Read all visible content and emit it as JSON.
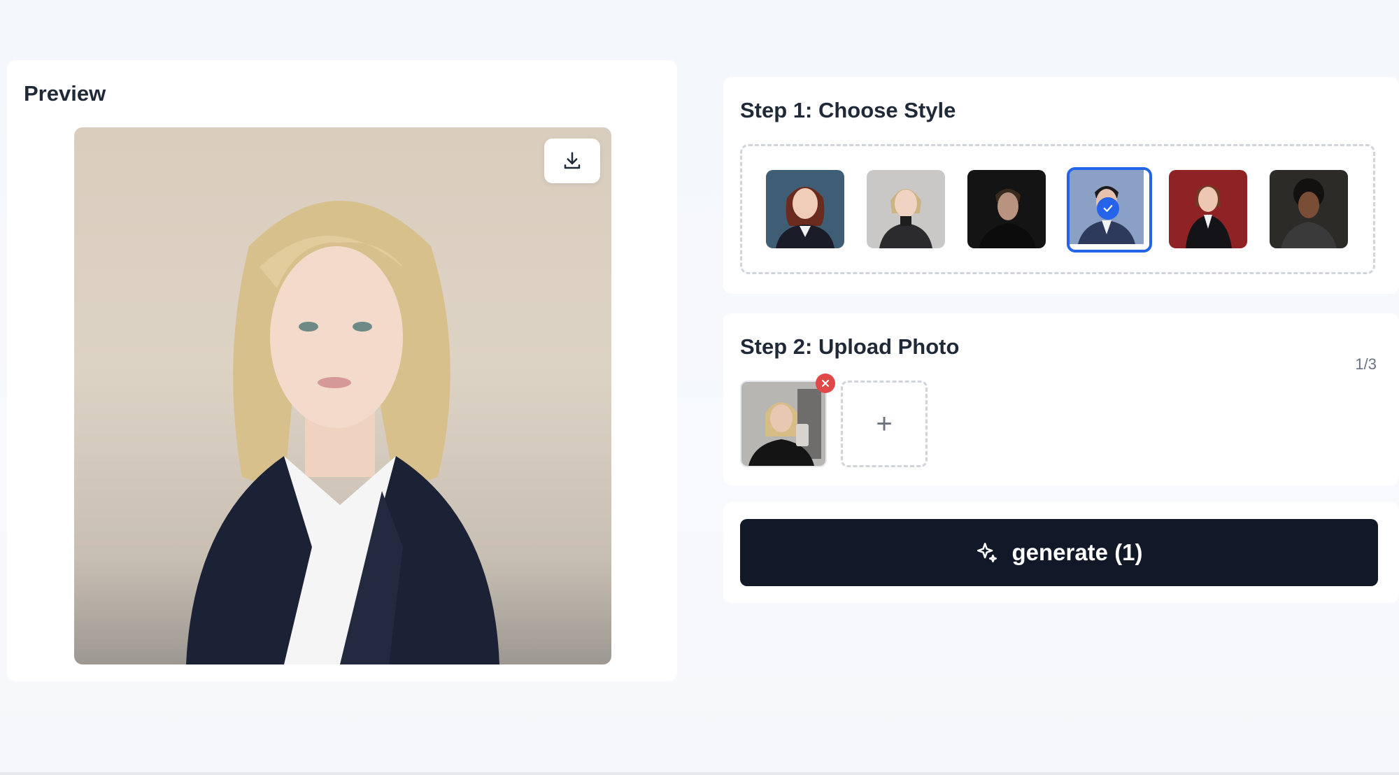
{
  "preview": {
    "title": "Preview",
    "download_icon": "download-icon"
  },
  "step1": {
    "title": "Step 1: Choose Style",
    "styles": [
      {
        "name": "style-1",
        "bg": "#3f5e75",
        "selected": false
      },
      {
        "name": "style-2",
        "bg": "#c9c8c6",
        "selected": false
      },
      {
        "name": "style-3",
        "bg": "#141414",
        "selected": false
      },
      {
        "name": "style-4",
        "bg": "#8aa0c4",
        "selected": true
      },
      {
        "name": "style-5",
        "bg": "#8e2224",
        "selected": false
      },
      {
        "name": "style-6",
        "bg": "#2c2b28",
        "selected": false
      }
    ],
    "check_icon": "check-icon"
  },
  "step2": {
    "title": "Step 2: Upload Photo",
    "counter": "1/3",
    "add_label": "+",
    "remove_icon": "close-icon"
  },
  "generate": {
    "label": "generate (1)",
    "icon": "sparkles-icon"
  },
  "colors": {
    "accent": "#2563eb",
    "button_dark": "#111827",
    "remove_red": "#e04848"
  }
}
